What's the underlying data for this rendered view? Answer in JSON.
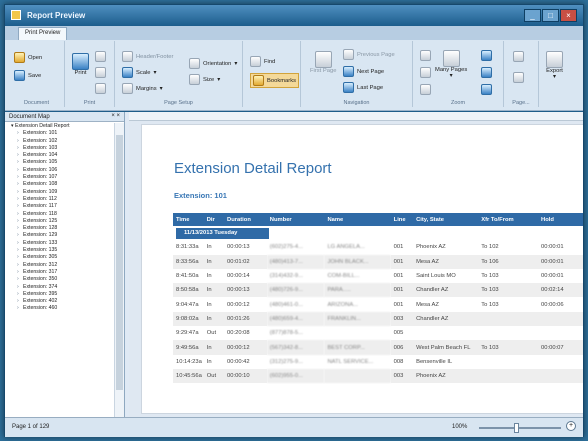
{
  "window": {
    "title": "Report Preview",
    "controls": [
      "_",
      "□",
      "×"
    ]
  },
  "ribbon": {
    "tab": "Print Preview",
    "document": {
      "label": "Document",
      "open": "Open",
      "save": "Save"
    },
    "print": {
      "label": "Print",
      "print": "Print"
    },
    "page_setup": {
      "label": "Page Setup",
      "header_footer": "Header/Footer",
      "scale": "Scale",
      "margins": "Margins",
      "orientation": "Orientation",
      "size": "Size"
    },
    "find_tools": {
      "find": "Find",
      "bookmarks": "Bookmarks"
    },
    "navigation": {
      "label": "Navigation",
      "first_page": "First Page",
      "previous_page": "Previous Page",
      "next_page": "Next Page",
      "last_page": "Last Page"
    },
    "zoom": {
      "label": "Zoom",
      "many_pages": "Many Pages"
    },
    "page_background": {
      "label": "Page..."
    },
    "export": {
      "label": "Export"
    }
  },
  "document_map": {
    "title": "Document Map",
    "root": "Extension Detail Report",
    "items": [
      "Extension: 101",
      "Extension: 102",
      "Extension: 103",
      "Extension: 104",
      "Extension: 105",
      "Extension: 106",
      "Extension: 107",
      "Extension: 108",
      "Extension: 109",
      "Extension: 112",
      "Extension: 117",
      "Extension: 118",
      "Extension: 125",
      "Extension: 128",
      "Extension: 129",
      "Extension: 133",
      "Extension: 135",
      "Extension: 305",
      "Extension: 312",
      "Extension: 317",
      "Extension: 350",
      "Extension: 374",
      "Extension: 395",
      "Extension: 402",
      "Extension: 460"
    ]
  },
  "report": {
    "title": "Extension Detail Report",
    "extension": "Extension: 101",
    "columns": [
      "Time",
      "Dir",
      "Duration",
      "Number",
      "Name",
      "Line",
      "City, State",
      "Xfr To/From",
      "Hold"
    ],
    "date": "11/13/2013 Tuesday",
    "rows": [
      {
        "time": "8:31:33a",
        "dir": "In",
        "duration": "00:00:13",
        "number": "(602)275-4...",
        "name": "LG ANGELA...",
        "line": "001",
        "city": "Phoenix AZ",
        "xfr": "To 102",
        "hold": "00:00:01"
      },
      {
        "time": "8:33:56a",
        "dir": "In",
        "duration": "00:01:02",
        "number": "(480)413-7...",
        "name": "JOHN BLACK...",
        "line": "001",
        "city": "Mesa AZ",
        "xfr": "To 106",
        "hold": "00:00:01"
      },
      {
        "time": "8:41:50a",
        "dir": "In",
        "duration": "00:00:14",
        "number": "(314)432-9...",
        "name": "COM-BILL...",
        "line": "001",
        "city": "Saint Louis MO",
        "xfr": "To 103",
        "hold": "00:00:01"
      },
      {
        "time": "8:50:58a",
        "dir": "In",
        "duration": "00:00:13",
        "number": "(480)726-9...",
        "name": "PARA.....",
        "line": "001",
        "city": "Chandler AZ",
        "xfr": "To 103",
        "hold": "00:02:14"
      },
      {
        "time": "9:04:47a",
        "dir": "In",
        "duration": "00:00:12",
        "number": "(480)461-0...",
        "name": "ARIZONA...",
        "line": "001",
        "city": "Mesa AZ",
        "xfr": "To 103",
        "hold": "00:00:06"
      },
      {
        "time": "9:08:02a",
        "dir": "In",
        "duration": "00:01:26",
        "number": "(480)659-4...",
        "name": "FRANKLIN...",
        "line": "003",
        "city": "Chandler AZ",
        "xfr": "",
        "hold": ""
      },
      {
        "time": "9:29:47a",
        "dir": "Out",
        "duration": "00:20:08",
        "number": "(877)878-5...",
        "name": "",
        "line": "005",
        "city": "",
        "xfr": "",
        "hold": ""
      },
      {
        "time": "9:49:56a",
        "dir": "In",
        "duration": "00:00:12",
        "number": "(567)342-8...",
        "name": "BEST CORP...",
        "line": "006",
        "city": "West Palm Beach FL",
        "xfr": "To 103",
        "hold": "00:00:07"
      },
      {
        "time": "10:14:23a",
        "dir": "In",
        "duration": "00:00:42",
        "number": "(312)275-9...",
        "name": "NATL SERVICE...",
        "line": "008",
        "city": "Bensenville IL",
        "xfr": "",
        "hold": ""
      },
      {
        "time": "10:45:56a",
        "dir": "Out",
        "duration": "00:00:10",
        "number": "(602)955-0...",
        "name": "",
        "line": "003",
        "city": "Phoenix AZ",
        "xfr": "",
        "hold": ""
      }
    ]
  },
  "status": {
    "page_info": "Page 1 of 129",
    "zoom": "100%"
  }
}
